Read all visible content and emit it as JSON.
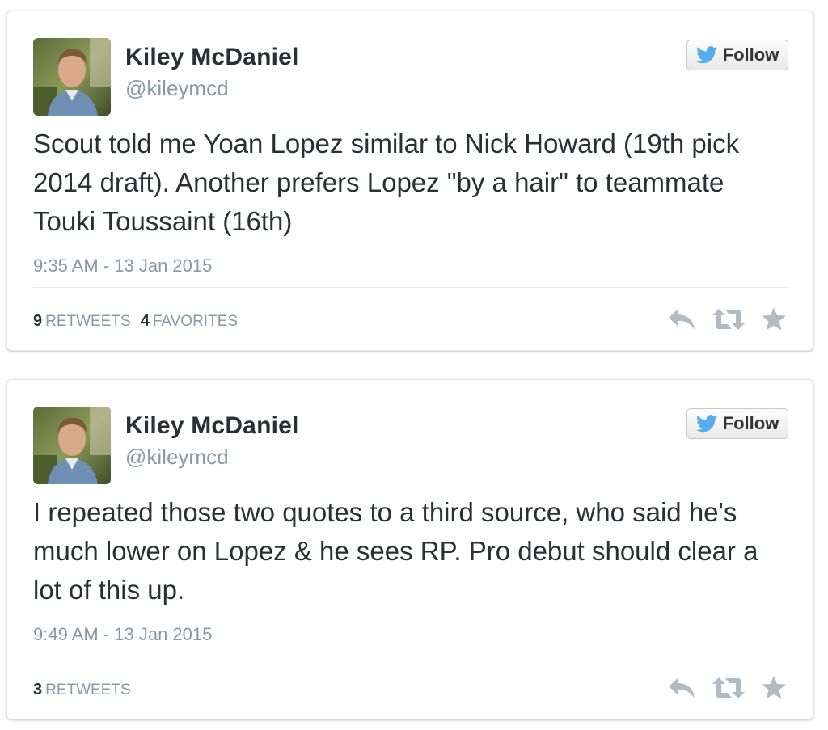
{
  "tweets": [
    {
      "author_name": "Kiley McDaniel",
      "author_handle": "@kileymcd",
      "follow_label": "Follow",
      "text": "Scout told me Yoan Lopez similar to Nick Howard (19th pick 2014 draft). Another prefers Lopez \"by a hair\" to teammate Touki Toussaint (16th)",
      "timestamp": "9:35 AM - 13 Jan 2015",
      "retweets_count": "9",
      "retweets_label": "RETWEETS",
      "favorites_count": "4",
      "favorites_label": "FAVORITES"
    },
    {
      "author_name": "Kiley McDaniel",
      "author_handle": "@kileymcd",
      "follow_label": "Follow",
      "text": "I repeated those two quotes to a third source, who said he's much lower on Lopez & he sees RP. Pro debut should clear a lot of this up.",
      "timestamp": "9:49 AM - 13 Jan 2015",
      "retweets_count": "3",
      "retweets_label": "RETWEETS"
    }
  ],
  "icons": {
    "twitter_bird": "bird-icon",
    "reply": "reply-icon",
    "retweet": "retweet-icon",
    "favorite": "star-icon"
  },
  "colors": {
    "twitter_blue": "#55acee",
    "text": "#292f33",
    "muted": "#8899a6",
    "action_icon": "#b1bbc3"
  }
}
